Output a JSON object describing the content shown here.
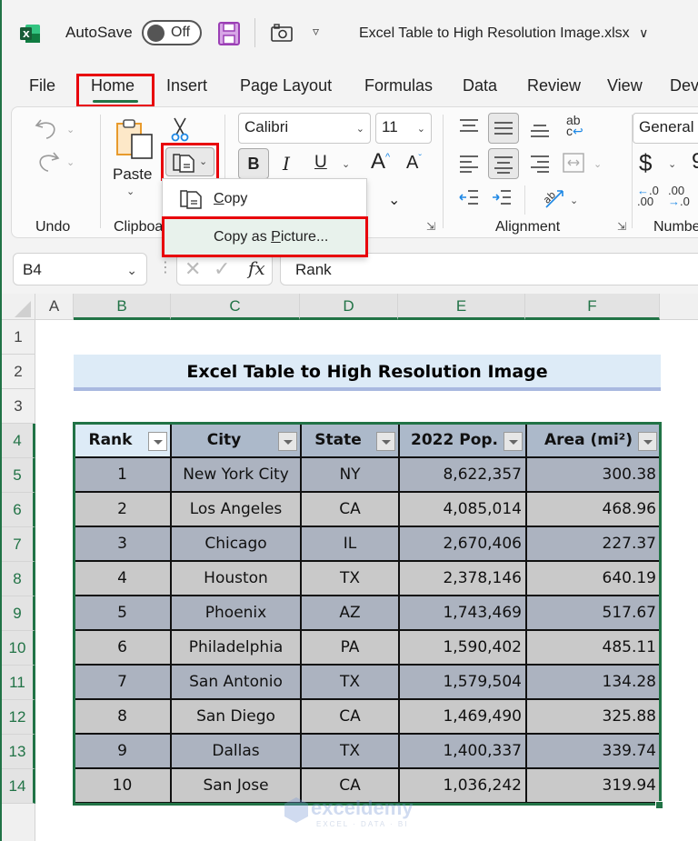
{
  "titlebar": {
    "autosave_label": "AutoSave",
    "autosave_state": "Off",
    "document_title": "Excel Table to High Resolution Image.xlsx",
    "title_chevron": "∨"
  },
  "menu_tabs": [
    "File",
    "Home",
    "Insert",
    "Page Layout",
    "Formulas",
    "Data",
    "Review",
    "View",
    "Dev"
  ],
  "active_tab": "Home",
  "ribbon": {
    "undo_group_label": "Undo",
    "clipboard_group_label": "Clipboa",
    "paste_label": "Paste",
    "font_name": "Calibri",
    "font_size": "11",
    "bold_label": "B",
    "italic_label": "I",
    "underline_label": "U",
    "grow_font_label": "A",
    "shrink_font_label": "A",
    "alignment_group_label": "Alignment",
    "number_format": "General",
    "currency_label": "$",
    "number_group_label": "Numbe"
  },
  "copy_menu": {
    "items": [
      {
        "label_prefix": "",
        "accel": "C",
        "label_rest": "opy"
      },
      {
        "label_prefix": "Copy as ",
        "accel": "P",
        "label_rest": "icture..."
      }
    ]
  },
  "formula_bar": {
    "name_box": "B4",
    "fx_label": "fx",
    "formula_value": "Rank"
  },
  "grid": {
    "columns": [
      "A",
      "B",
      "C",
      "D",
      "E",
      "F"
    ],
    "rows": [
      "1",
      "2",
      "3",
      "4",
      "5",
      "6",
      "7",
      "8",
      "9",
      "10",
      "11",
      "12",
      "13",
      "14"
    ],
    "selected_column": "B",
    "selected_row": "4"
  },
  "sheet": {
    "title": "Excel Table to High Resolution Image",
    "table": {
      "headers": [
        "Rank",
        "City",
        "State",
        "2022 Pop.",
        "Area (mi²)"
      ],
      "rows": [
        [
          "1",
          "New York City",
          "NY",
          "8,622,357",
          "300.38"
        ],
        [
          "2",
          "Los Angeles",
          "CA",
          "4,085,014",
          "468.96"
        ],
        [
          "3",
          "Chicago",
          "IL",
          "2,670,406",
          "227.37"
        ],
        [
          "4",
          "Houston",
          "TX",
          "2,378,146",
          "640.19"
        ],
        [
          "5",
          "Phoenix",
          "AZ",
          "1,743,469",
          "517.67"
        ],
        [
          "6",
          "Philadelphia",
          "PA",
          "1,590,402",
          "485.11"
        ],
        [
          "7",
          "San Antonio",
          "TX",
          "1,579,504",
          "134.28"
        ],
        [
          "8",
          "San Diego",
          "CA",
          "1,469,490",
          "325.88"
        ],
        [
          "9",
          "Dallas",
          "TX",
          "1,400,337",
          "339.74"
        ],
        [
          "10",
          "San Jose",
          "CA",
          "1,036,242",
          "319.94"
        ]
      ]
    }
  },
  "watermark": {
    "brand": "exceldemy",
    "tagline": "EXCEL · DATA · BI"
  },
  "colors": {
    "excel_green": "#217346",
    "highlight_red": "#e8000b",
    "title_fill": "#ddebf7",
    "header_fill": "#acb9ca",
    "band_dark": "#acb3c0",
    "band_light": "#c9c9c9"
  }
}
